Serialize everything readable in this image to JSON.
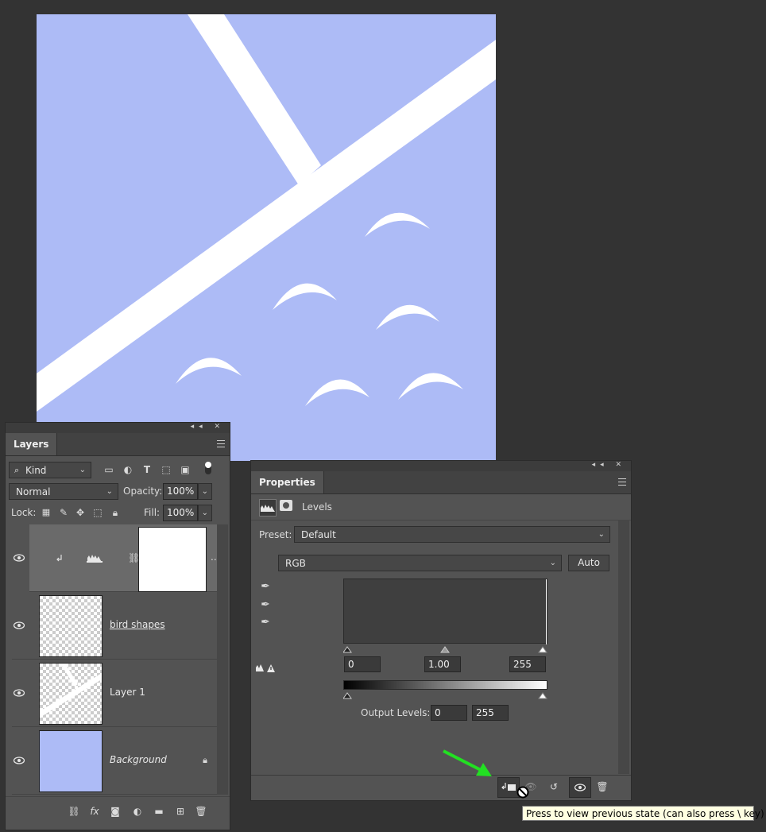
{
  "layers_panel": {
    "tab": "Layers",
    "filter_kind": "Kind",
    "blend_mode": "Normal",
    "opacity_label": "Opacity:",
    "opacity_value": "100%",
    "lock_label": "Lock:",
    "fill_label": "Fill:",
    "fill_value": "100%",
    "layers": [
      {
        "name": "",
        "type": "levels-adjustment",
        "selected": true
      },
      {
        "name": "bird shapes",
        "type": "pixel"
      },
      {
        "name": "Layer 1",
        "type": "pixel"
      },
      {
        "name": "Background",
        "type": "background",
        "locked": true
      }
    ],
    "fx_label": "fx"
  },
  "properties_panel": {
    "tab": "Properties",
    "title": "Levels",
    "preset_label": "Preset:",
    "preset_value": "Default",
    "channel": "RGB",
    "auto_button": "Auto",
    "input_levels": {
      "black": "0",
      "gamma": "1.00",
      "white": "255"
    },
    "output_label": "Output Levels:",
    "output_levels": {
      "black": "0",
      "white": "255"
    }
  },
  "tooltip": "Press to view previous state (can also press \\ key)",
  "colors": {
    "canvas_bg": "#adbbf6",
    "workspace": "#333333",
    "panel": "#535353",
    "annotation_arrow": "#22e022"
  }
}
